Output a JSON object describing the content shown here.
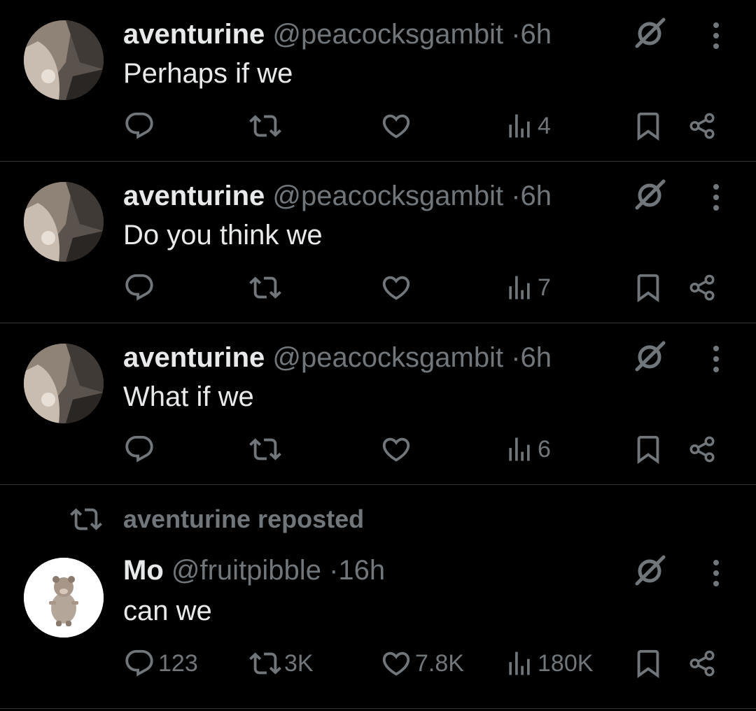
{
  "posts": [
    {
      "name": "aventurine",
      "handle": "@peacocksgambit",
      "sep": "·",
      "time": "6h",
      "text": "Perhaps if we",
      "replies": "",
      "reposts": "",
      "likes": "",
      "views": "4"
    },
    {
      "name": "aventurine",
      "handle": "@peacocksgambit",
      "sep": "·",
      "time": "6h",
      "text": "Do you think we",
      "replies": "",
      "reposts": "",
      "likes": "",
      "views": "7"
    },
    {
      "name": "aventurine",
      "handle": "@peacocksgambit",
      "sep": "·",
      "time": "6h",
      "text": "What if we",
      "replies": "",
      "reposts": "",
      "likes": "",
      "views": "6"
    },
    {
      "repost_label": "aventurine reposted",
      "name": "Mo",
      "handle": "@fruitpibble",
      "sep": "·",
      "time": "16h",
      "text": "can we",
      "replies": "123",
      "reposts": "3K",
      "likes": "7.8K",
      "views": "180K"
    }
  ],
  "icons": {
    "reply": "reply-icon",
    "repost": "repost-icon",
    "like": "heart-icon",
    "views": "views-icon",
    "bookmark": "bookmark-icon",
    "share": "share-icon",
    "grok": "grok-icon",
    "more": "more-icon"
  },
  "colors": {
    "background": "#000000",
    "text": "#e7e9ea",
    "muted": "#71767b",
    "divider": "#2f3336"
  }
}
